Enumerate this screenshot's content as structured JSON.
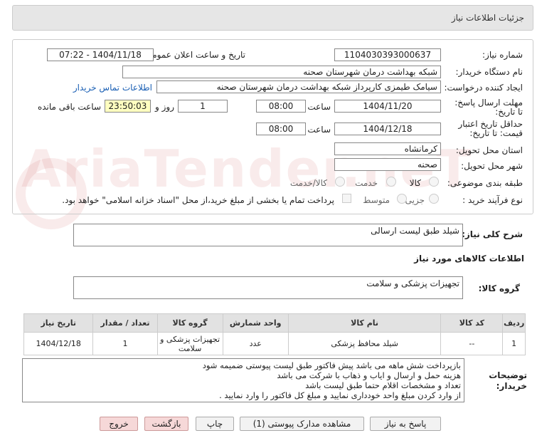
{
  "header": {
    "title": "جزئیات اطلاعات نیاز"
  },
  "watermark": "AriaTender.neT",
  "form": {
    "need_number_label": "شماره نیاز:",
    "need_number": "1104030393000637",
    "announce_label": "تاریخ و ساعت اعلان عمومی:",
    "announce_value": "1404/11/18 - 07:22",
    "buyer_label": "نام دستگاه خریدار:",
    "buyer_value": "شبکه بهداشت درمان شهرستان صحنه",
    "requester_label": "ایجاد کننده درخواست:",
    "requester_value": "سیامک طیمزی کارپرداز شبکه بهداشت درمان شهرستان صحنه",
    "contact_link": "اطلاعات تماس خریدار",
    "deadline_label": "مهلت ارسال پاسخ: تا تاریخ:",
    "deadline_date": "1404/11/20",
    "time_label": "ساعت",
    "deadline_time": "08:00",
    "days_value": "1",
    "days_label": "روز و",
    "remaining_time": "23:50:03",
    "remaining_label": "ساعت باقی مانده",
    "validity_label": "حداقل تاریخ اعتبار قیمت: تا تاریخ:",
    "validity_date": "1404/12/18",
    "validity_time": "08:00",
    "province_label": "استان محل تحویل:",
    "province_value": "کرمانشاه",
    "city_label": "شهر محل تحویل:",
    "city_value": "صحنه",
    "category_label": "طبقه بندی موضوعی:",
    "category_options": [
      "کالا",
      "خدمت",
      "کالا/خدمت"
    ],
    "purchase_type_label": "نوع فرآیند خرید :",
    "purchase_options": [
      "جزیی",
      "متوسط"
    ],
    "payment_note": "پرداخت تمام یا بخشی از مبلغ خرید،از محل \"اسناد خزانه اسلامی\" خواهد بود."
  },
  "description": {
    "label": "شرح کلی نیاز:",
    "value": "شیلد طبق لیست ارسالی"
  },
  "goods_section_title": "اطلاعات کالاهای مورد نیاز",
  "goods_group": {
    "label": "گروه کالا:",
    "value": "تجهیزات پزشکی و سلامت"
  },
  "table": {
    "headers": [
      "ردیف",
      "کد کالا",
      "نام کالا",
      "واحد شمارش",
      "گروه کالا",
      "تعداد / مقدار",
      "تاریخ نیاز"
    ],
    "rows": [
      [
        "1",
        "--",
        "شیلد محافظ پزشکی",
        "عدد",
        "تجهیزات پزشکی و سلامت",
        "1",
        "1404/12/18"
      ]
    ]
  },
  "buyer_notes": {
    "label": "توضیحات خریدار:",
    "lines": [
      "بازپرداخت شش ماهه می باشد پیش فاکتور طبق لیست پیوستی ضمیمه شود",
      "هزینه حمل و ارسال و ایاب و ذهاب با شرکت می باشد",
      "تعداد و مشخصات اقلام حتما طبق لیست باشد",
      "از وارد کردن مبلغ واحد خودداری نمایید و مبلغ کل فاکتور را وارد نمایید ."
    ]
  },
  "buttons": {
    "reply": "پاسخ به نیاز",
    "attachments": "مشاهده مدارک پیوستی (1)",
    "print": "چاپ",
    "back": "بازگشت",
    "exit": "خروج"
  }
}
